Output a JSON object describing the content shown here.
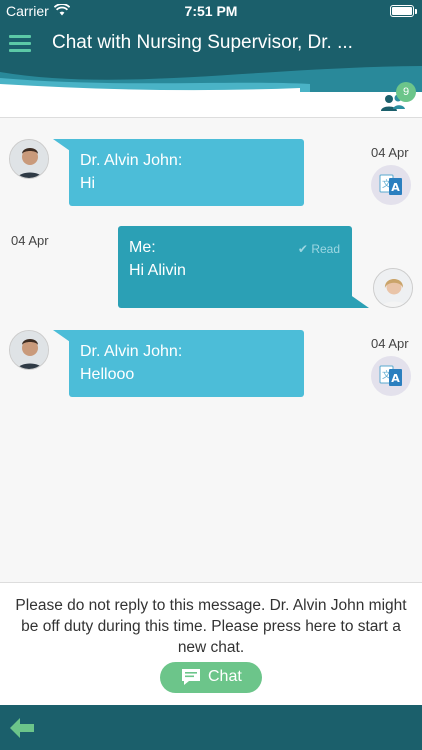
{
  "status_bar": {
    "carrier": "Carrier",
    "time": "7:51 PM"
  },
  "header": {
    "title": "Chat with Nursing Supervisor, Dr. ..."
  },
  "participants": {
    "count": "9"
  },
  "messages": [
    {
      "direction": "incoming",
      "sender": "Dr. Alvin John:",
      "text": "Hi",
      "date": "04 Apr"
    },
    {
      "direction": "outgoing",
      "sender": "Me:",
      "text": "Hi Alivin",
      "date": "04 Apr",
      "status": "Read"
    },
    {
      "direction": "incoming",
      "sender": "Dr. Alvin John:",
      "text": "Hellooo",
      "date": "04 Apr"
    }
  ],
  "notice": {
    "text": "Please do not reply to this message. Dr. Alvin John might be off duty during this time. Please press here to start a new chat.",
    "chat_button_label": "Chat"
  },
  "colors": {
    "header": "#1b5f6b",
    "incoming_bubble": "#4cbdd8",
    "outgoing_bubble": "#2ba0b5",
    "accent_green": "#6cc58a"
  },
  "icons": {
    "menu": "menu-icon",
    "participants": "group-icon",
    "translate": "translate-icon",
    "read": "check-icon",
    "chat": "chat-bubble-icon",
    "back": "back-arrow-icon"
  }
}
